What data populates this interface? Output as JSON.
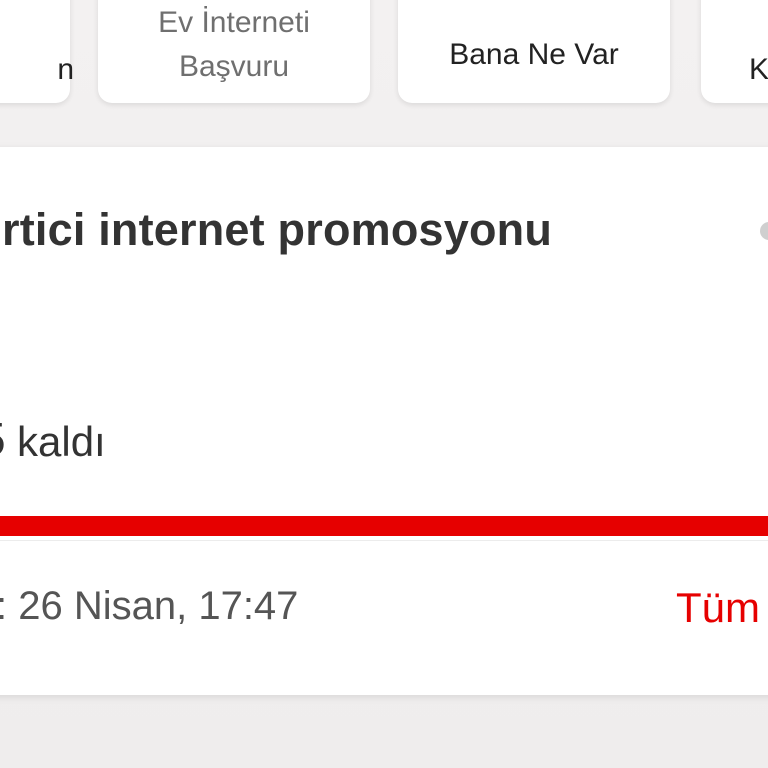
{
  "quick_actions": [
    {
      "label": "n"
    },
    {
      "label": "Ev İnterneti\nBaşvuru"
    },
    {
      "label": "Bana Ne Var"
    },
    {
      "label": "K"
    }
  ],
  "promo": {
    "title": "rtici internet promosyonu",
    "remaining_digit": "5",
    "remaining_label": "kaldı",
    "progress_percent": 100,
    "timestamp": ": 26 Nisan, 17:47",
    "see_all": "Tüm"
  },
  "colors": {
    "accent": "#e60000",
    "background": "#f2f0f0",
    "card": "#ffffff",
    "text": "#333333"
  }
}
